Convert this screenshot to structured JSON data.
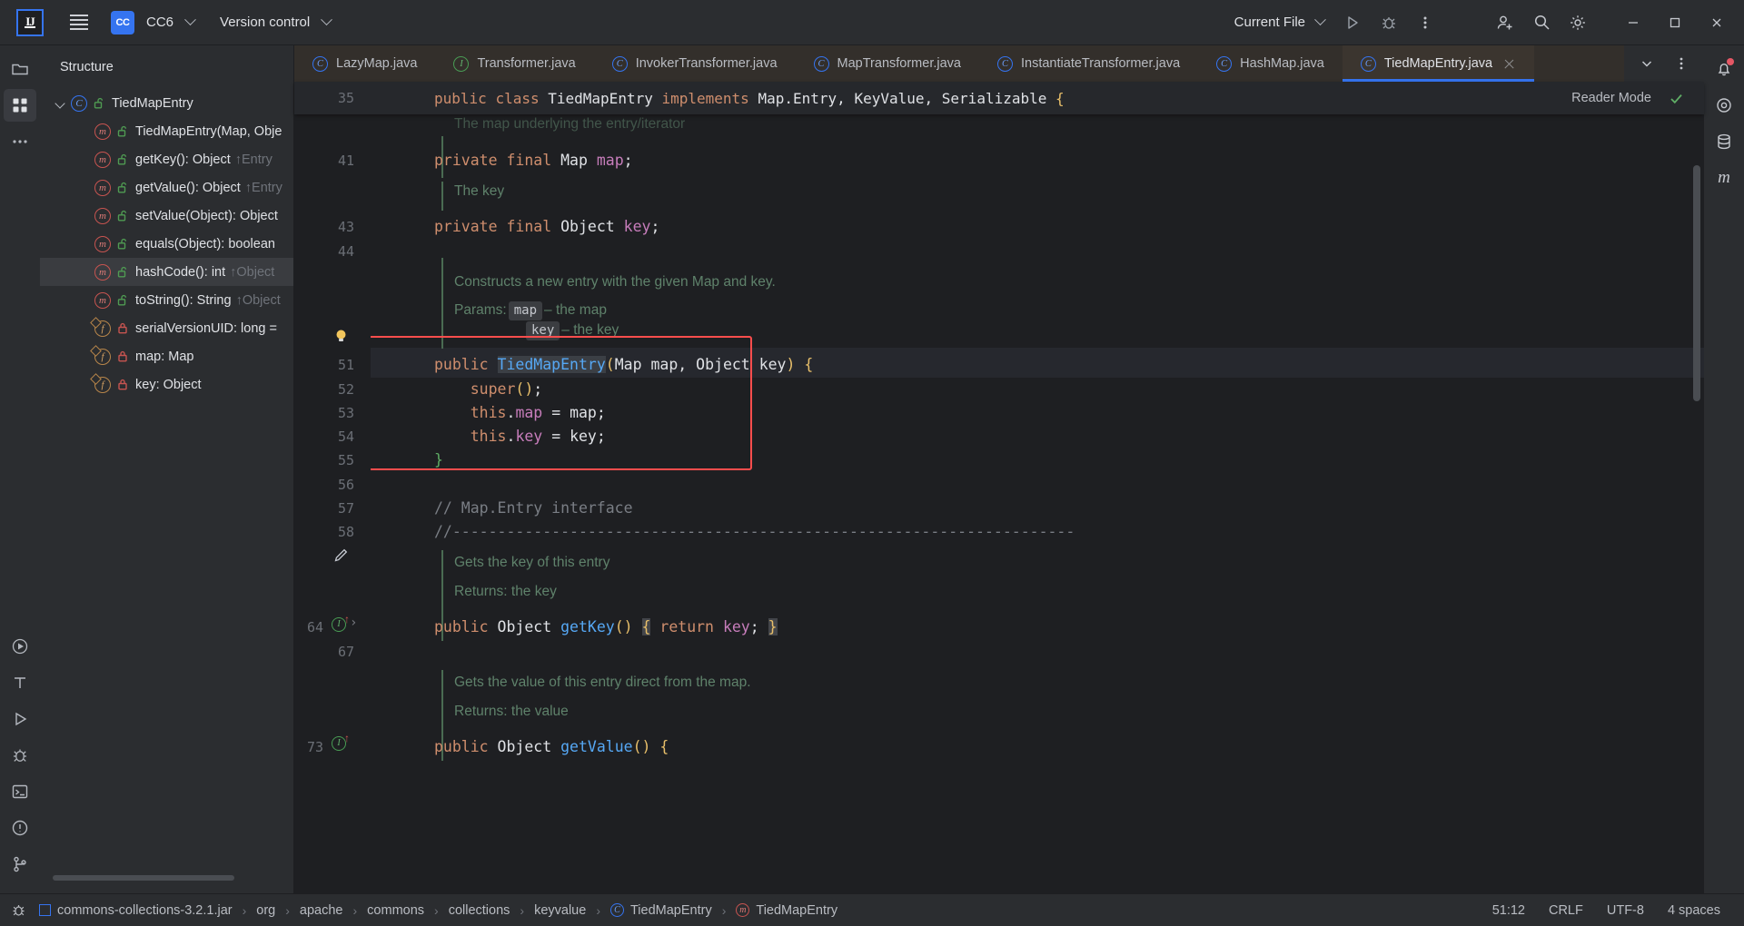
{
  "toolbar": {
    "logo_text": "IJ",
    "project_badge": "CC",
    "project_name": "CC6",
    "vcs_label": "Version control",
    "run_config": "Current File",
    "run_icon": "run-icon",
    "debug_icon": "debug-icon",
    "more_icon": "more-vertical-icon",
    "account_icon": "account-add-icon",
    "search_icon": "search-icon",
    "settings_icon": "gear-icon",
    "minimize_icon": "minimize-icon",
    "maximize_icon": "maximize-icon",
    "close_icon": "close-icon"
  },
  "rail": {
    "items": [
      {
        "name": "project-icon",
        "glyph": "folder"
      },
      {
        "name": "structure-icon",
        "glyph": "structure",
        "active": true
      },
      {
        "name": "more-tool-windows-icon",
        "glyph": "dots"
      }
    ],
    "bottom_items": [
      {
        "name": "run-tool-icon",
        "glyph": "play-circle"
      },
      {
        "name": "tool-window-icon",
        "glyph": "tee"
      },
      {
        "name": "services-icon",
        "glyph": "play"
      },
      {
        "name": "debug-tool-icon",
        "glyph": "bug"
      },
      {
        "name": "terminal-icon",
        "glyph": "terminal"
      },
      {
        "name": "problems-icon",
        "glyph": "exclaim"
      },
      {
        "name": "git-icon",
        "glyph": "branch"
      }
    ],
    "right_items": [
      {
        "name": "notifications-icon",
        "glyph": "bell"
      },
      {
        "name": "ai-assistant-icon",
        "glyph": "ai"
      },
      {
        "name": "database-icon",
        "glyph": "db"
      },
      {
        "name": "maven-icon",
        "glyph": "m"
      }
    ]
  },
  "structure": {
    "title": "Structure",
    "nodes": [
      {
        "indent": 0,
        "arrow": "open",
        "icon": "class",
        "lock": "public",
        "label": "TiedMapEntry",
        "sub": "",
        "selected": false
      },
      {
        "indent": 1,
        "arrow": "none",
        "icon": "method",
        "lock": "public",
        "label": "TiedMapEntry(Map, Obje",
        "sub": "",
        "selected": false
      },
      {
        "indent": 1,
        "arrow": "none",
        "icon": "method",
        "lock": "public",
        "label": "getKey(): Object",
        "sub": "↑Entry",
        "selected": false
      },
      {
        "indent": 1,
        "arrow": "none",
        "icon": "method",
        "lock": "public",
        "label": "getValue(): Object",
        "sub": "↑Entry",
        "selected": false
      },
      {
        "indent": 1,
        "arrow": "none",
        "icon": "method",
        "lock": "public",
        "label": "setValue(Object): Object",
        "sub": "",
        "selected": false
      },
      {
        "indent": 1,
        "arrow": "none",
        "icon": "method",
        "lock": "public",
        "label": "equals(Object): boolean",
        "sub": "",
        "selected": false
      },
      {
        "indent": 1,
        "arrow": "none",
        "icon": "method",
        "lock": "public",
        "label": "hashCode(): int",
        "sub": "↑Object",
        "selected": true
      },
      {
        "indent": 1,
        "arrow": "none",
        "icon": "method",
        "lock": "public",
        "label": "toString(): String",
        "sub": "↑Object",
        "selected": false
      },
      {
        "indent": 1,
        "arrow": "none",
        "icon": "field",
        "lock": "private",
        "label": "serialVersionUID: long =",
        "sub": "",
        "selected": false
      },
      {
        "indent": 1,
        "arrow": "none",
        "icon": "field",
        "lock": "private",
        "label": "map: Map",
        "sub": "",
        "selected": false
      },
      {
        "indent": 1,
        "arrow": "none",
        "icon": "field",
        "lock": "private",
        "label": "key: Object",
        "sub": "",
        "selected": false
      }
    ]
  },
  "tabs": {
    "items": [
      {
        "label": "LazyMap.java",
        "icon": "class",
        "active": false
      },
      {
        "label": "Transformer.java",
        "icon": "interface",
        "active": false
      },
      {
        "label": "InvokerTransformer.java",
        "icon": "class",
        "active": false
      },
      {
        "label": "MapTransformer.java",
        "icon": "class",
        "active": false
      },
      {
        "label": "InstantiateTransformer.java",
        "icon": "class",
        "active": false
      },
      {
        "label": "HashMap.java",
        "icon": "class",
        "active": false
      },
      {
        "label": "TiedMapEntry.java",
        "icon": "class",
        "active": true
      }
    ],
    "overflow_icon": "chevron-down-icon",
    "options_icon": "more-vertical-icon"
  },
  "sticky_header": {
    "line_number": "35",
    "text": "public class TiedMapEntry implements Map.Entry, KeyValue, Serializable {",
    "reader_mode_label": "Reader Mode",
    "inspection_icon": "check-icon"
  },
  "editor": {
    "doc_line_top": "The map underlying the entry/iterator",
    "lines": [
      {
        "num": "41",
        "text": "private final Map map;"
      },
      {
        "num": "43",
        "text": "private final Object key;"
      },
      {
        "num": "44",
        "text": ""
      },
      {
        "num": "51",
        "text": "public TiedMapEntry(Map map, Object key) {"
      },
      {
        "num": "52",
        "text": "super();"
      },
      {
        "num": "53",
        "text": "this.map = map;"
      },
      {
        "num": "54",
        "text": "this.key = key;"
      },
      {
        "num": "55",
        "text": "}"
      },
      {
        "num": "56",
        "text": ""
      },
      {
        "num": "57",
        "text": "// Map.Entry interface"
      },
      {
        "num": "58",
        "text": "//------------------------------------------------------------------"
      },
      {
        "num": "64",
        "text": "public Object getKey() { return key; }"
      },
      {
        "num": "67",
        "text": ""
      },
      {
        "num": "73",
        "text": "public Object getValue() {"
      }
    ],
    "docs": {
      "key_doc": "The key",
      "ctor_doc": "Constructs a new entry with the given Map and key.",
      "params_label": "Params:",
      "param_map_name": "map",
      "param_map_desc": "– the map",
      "param_key_name": "key",
      "param_key_desc": "– the key",
      "getkey_doc": "Gets the key of this entry",
      "getkey_returns": "Returns: the key",
      "getvalue_doc": "Gets the value of this entry direct from the map.",
      "getvalue_returns": "Returns: the value"
    },
    "bulb_icon": "lightbulb-icon",
    "pencil_icon": "pencil-icon",
    "highlight_color": "#ff4d4d"
  },
  "breadcrumbs": {
    "items": [
      {
        "label": "commons-collections-3.2.1.jar",
        "icon": "jar"
      },
      {
        "label": "org",
        "icon": "none"
      },
      {
        "label": "apache",
        "icon": "none"
      },
      {
        "label": "commons",
        "icon": "none"
      },
      {
        "label": "collections",
        "icon": "none"
      },
      {
        "label": "keyvalue",
        "icon": "none"
      },
      {
        "label": "TiedMapEntry",
        "icon": "class"
      },
      {
        "label": "TiedMapEntry",
        "icon": "method"
      }
    ],
    "separator": "›",
    "caret_position": "51:12",
    "line_separator": "CRLF",
    "encoding": "UTF-8",
    "indent": "4 spaces",
    "bug_icon": "debug-icon"
  }
}
